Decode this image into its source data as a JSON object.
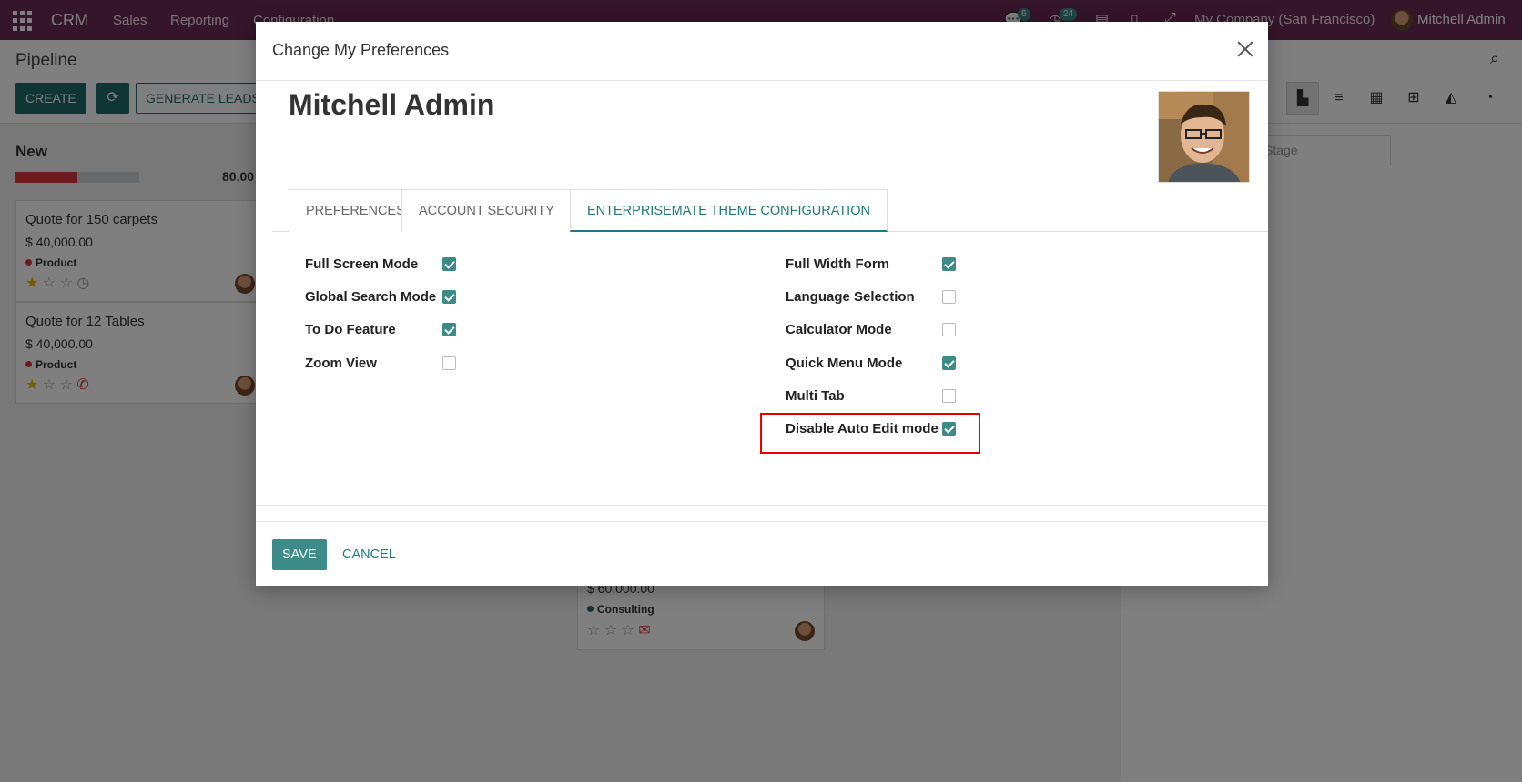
{
  "topnav": {
    "brand": "CRM",
    "menu": [
      "Sales",
      "Reporting",
      "Configuration"
    ],
    "chat_count": "6",
    "activity_count": "24",
    "company": "My Company (San Francisco)",
    "user": "Mitchell Admin"
  },
  "control": {
    "breadcrumb": "Pipeline",
    "create_label": "CREATE",
    "generate_label": "GENERATE LEADS",
    "stage_placeholder": "Stage"
  },
  "kanban": {
    "column_title": "New",
    "column_total": "80,00",
    "progress_fraction": 0.5,
    "cards": [
      {
        "title": "Quote for 150 carpets",
        "amount": "$ 40,000.00",
        "tag": "Product"
      },
      {
        "title": "Quote for 12 Tables",
        "amount": "$ 40,000.00",
        "tag": "Product"
      }
    ],
    "mid_card": {
      "amount": "$ 60,000.00",
      "tag": "Consulting"
    }
  },
  "modal": {
    "title": "Change My Preferences",
    "user_name": "Mitchell Admin",
    "tabs": [
      "PREFERENCES",
      "ACCOUNT SECURITY",
      "ENTERPRISEMATE THEME CONFIGURATION"
    ],
    "active_tab": 2,
    "left_fields": [
      {
        "label": "Full Screen Mode",
        "checked": true
      },
      {
        "label": "Global Search Mode",
        "checked": true
      },
      {
        "label": "To Do Feature",
        "checked": true
      },
      {
        "label": "Zoom View",
        "checked": false
      }
    ],
    "right_fields": [
      {
        "label": "Full Width Form",
        "checked": true
      },
      {
        "label": "Language Selection",
        "checked": false
      },
      {
        "label": "Calculator Mode",
        "checked": false
      },
      {
        "label": "Quick Menu Mode",
        "checked": true
      },
      {
        "label": "Multi Tab",
        "checked": false
      },
      {
        "label": "Disable Auto Edit mode",
        "checked": true
      }
    ],
    "save_label": "SAVE",
    "cancel_label": "CANCEL"
  },
  "colors": {
    "nav": "#6b2a53",
    "accent": "#3d8b89",
    "highlight": "#e00000"
  }
}
